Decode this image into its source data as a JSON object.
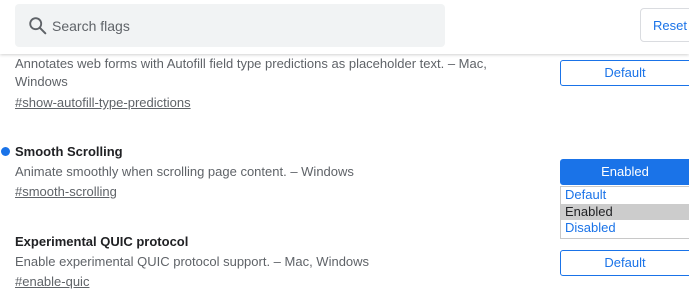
{
  "search": {
    "placeholder": "Search flags"
  },
  "header": {
    "reset_label": "Reset all"
  },
  "flags": [
    {
      "title": "",
      "description": "Annotates web forms with Autofill field type predictions as placeholder text. – Mac, Windows",
      "link": "#show-autofill-type-predictions",
      "select_value": "Default",
      "modified": false
    },
    {
      "title": "Smooth Scrolling",
      "description": "Animate smoothly when scrolling page content. – Windows",
      "link": "#smooth-scrolling",
      "select_value": "Enabled",
      "modified": true,
      "dropdown_open": true,
      "options": [
        "Default",
        "Enabled",
        "Disabled"
      ],
      "highlighted_option": "Enabled"
    },
    {
      "title": "Experimental QUIC protocol",
      "description": "Enable experimental QUIC protocol support. – Mac, Windows",
      "link": "#enable-quic",
      "select_value": "Default",
      "modified": false
    }
  ],
  "colors": {
    "accent": "#1a73e8",
    "text_primary": "#202124",
    "text_secondary": "#5f6368",
    "selected_option_bg": "#cccccc"
  },
  "icons": {
    "search": "search-icon",
    "modified_indicator": "modified-dot-icon"
  }
}
